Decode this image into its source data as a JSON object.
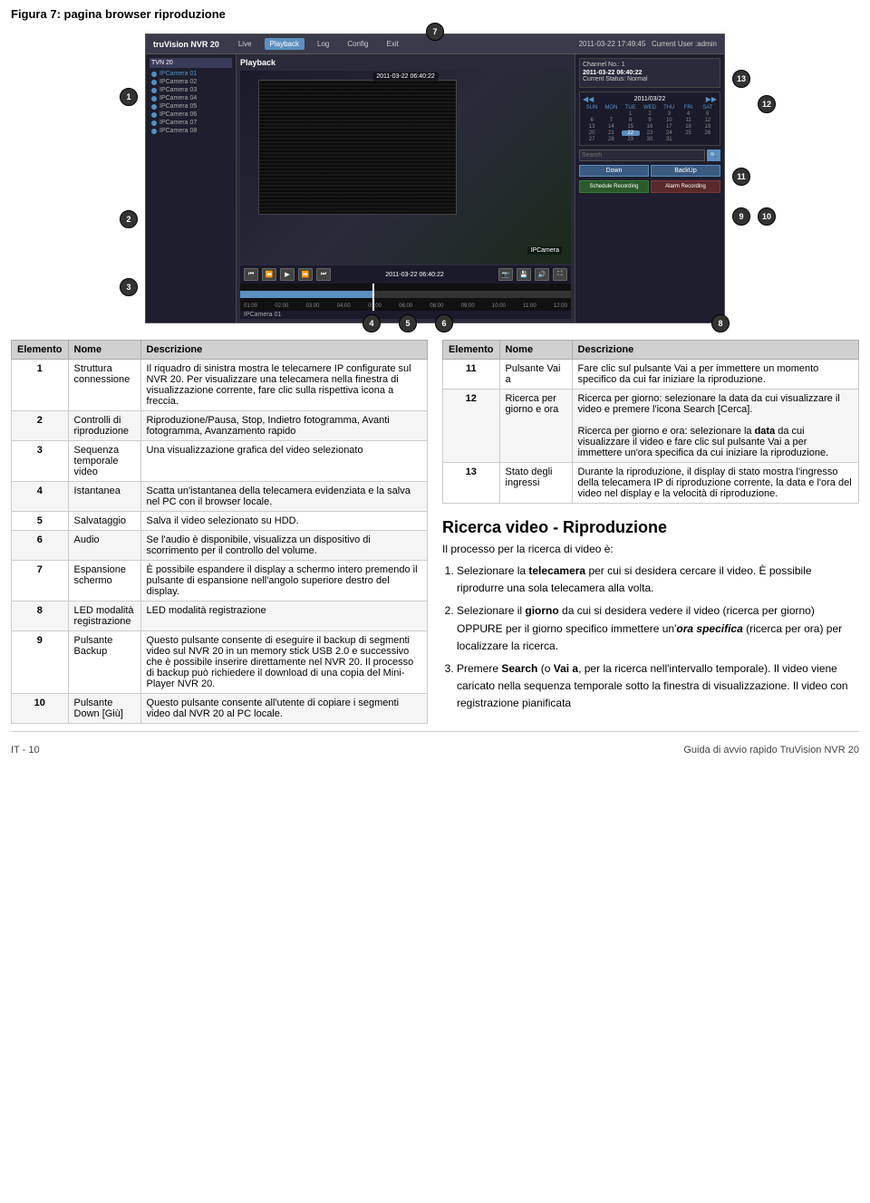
{
  "page": {
    "title": "Figura 7: pagina browser riproduzione",
    "footer_left": "IT - 10",
    "footer_right": "Guida di avvio rapido TruVision NVR 20"
  },
  "nvr_ui": {
    "logo": "truVision NVR 20",
    "nav_items": [
      "Live",
      "Playback",
      "Log",
      "Config",
      "Exit"
    ],
    "active_nav": "Playback",
    "timestamp": "2011-03-22 17:49:45",
    "current_user": "Current User :admin",
    "sidebar_title": "TVN 20",
    "cameras": [
      "IPCamera 01",
      "IPCamera 02",
      "IPCamera 03",
      "IPCamera 04",
      "IPCamera 05",
      "IPCamera 06",
      "IPCamera 07",
      "IPCamera 08"
    ],
    "playback_title": "Playback",
    "video_timestamp": "2011-03-22 06:40:22",
    "cam_label": "IPCamera 01",
    "timeline_times": [
      "01:00",
      "02:00",
      "03:00",
      "04:00",
      "05:00",
      "06:00",
      "07:00",
      "08:00",
      "09:00",
      "10:00",
      "11:00",
      "12:00"
    ],
    "channel_no": "Channel No.: 1",
    "channel_time": "2011-03-22 06:40:22",
    "status": "Current Status: Normal",
    "calendar_title": "2011/03/22",
    "calendar_month": "2011/03/22",
    "search_placeholder": "Search",
    "down_btn": "Down",
    "backup_btn": "BackUp",
    "schedule_btn": "Schedule Recording",
    "alarm_btn": "Alarm Recording"
  },
  "callout_numbers": [
    "1",
    "2",
    "3",
    "4",
    "5",
    "6",
    "7",
    "8",
    "9",
    "10",
    "11",
    "12",
    "13"
  ],
  "left_table": {
    "headers": [
      "Elemento",
      "Nome",
      "Descrizione"
    ],
    "rows": [
      {
        "num": "1",
        "name": "Struttura connessione",
        "desc": "Il riquadro di sinistra mostra le telecamere IP configurate sul NVR 20. Per visualizzare una telecamera nella finestra di visualizzazione corrente, fare clic sulla rispettiva icona a freccia."
      },
      {
        "num": "2",
        "name": "Controlli di riproduzione",
        "desc": "Riproduzione/Pausa, Stop, Indietro fotogramma, Avanti fotogramma, Avanzamento rapido"
      },
      {
        "num": "3",
        "name": "Sequenza temporale video",
        "desc": "Una visualizzazione grafica del video selezionato"
      },
      {
        "num": "4",
        "name": "Istantanea",
        "desc": "Scatta un'istantanea della telecamera evidenziata e la salva nel PC con il browser locale."
      },
      {
        "num": "5",
        "name": "Salvataggio",
        "desc": "Salva il video selezionato su HDD."
      },
      {
        "num": "6",
        "name": "Audio",
        "desc": "Se l'audio è disponibile, visualizza un dispositivo di scorrimento per il controllo del volume."
      },
      {
        "num": "7",
        "name": "Espansione schermo",
        "desc": "È possibile espandere il display a schermo intero premendo il pulsante di espansione nell'angolo superiore destro del display."
      },
      {
        "num": "8",
        "name": "LED modalità registrazione",
        "desc": "LED modalità registrazione"
      },
      {
        "num": "9",
        "name": "Pulsante Backup",
        "desc": "Questo pulsante consente di eseguire il backup di segmenti video sul NVR 20 in un memory stick USB 2.0 e successivo che è possibile inserire direttamente nel NVR 20. Il processo di backup può richiedere il download di una copia del Mini-Player NVR 20."
      },
      {
        "num": "10",
        "name": "Pulsante Down [Giù]",
        "desc": "Questo pulsante consente all'utente di copiare i segmenti video dal NVR 20 al PC locale."
      }
    ]
  },
  "right_table": {
    "headers": [
      "Elemento",
      "Nome",
      "Descrizione"
    ],
    "rows": [
      {
        "num": "11",
        "name": "Pulsante Vai a",
        "desc": "Fare clic sul pulsante Vai a per immettere un momento specifico da cui far iniziare la riproduzione."
      },
      {
        "num": "12",
        "name": "Ricerca per giorno e ora",
        "desc": "Ricerca per giorno: selezionare la data da cui visualizzare il video e premere l'icona Search [Cerca].\n\nRicerca per giorno e ora: selezionare la data da cui visualizzare il video e fare clic sul pulsante Vai a per immettere un'ora specifica da cui iniziare la riproduzione."
      },
      {
        "num": "13",
        "name": "Stato degli ingressi",
        "desc": "Durante la riproduzione, il display di stato mostra l'ingresso della telecamera IP di riproduzione corrente, la data e l'ora del video nel display e la velocità di riproduzione."
      }
    ]
  },
  "right_section": {
    "title": "Ricerca video - Riproduzione",
    "subtitle": "Il processo per la ricerca di video è:",
    "steps": [
      {
        "num": "1",
        "text_parts": [
          {
            "text": "Selezionare la ",
            "style": "normal"
          },
          {
            "text": "telecamera",
            "style": "bold"
          },
          {
            "text": " per cui si desidera cercare il video. È possibile riprodurre una sola telecamera alla volta.",
            "style": "normal"
          }
        ],
        "full_text": "Selezionare la telecamera per cui si desidera cercare il video. È possibile riprodurre una sola telecamera alla volta."
      },
      {
        "num": "2",
        "text_parts": [
          {
            "text": "Selezionare il ",
            "style": "normal"
          },
          {
            "text": "giorno",
            "style": "bold"
          },
          {
            "text": " da cui si desidera vedere il video (ricerca per giorno) OPPURE per il giorno specifico immettere un'",
            "style": "normal"
          },
          {
            "text": "ora specifica",
            "style": "bold-italic"
          },
          {
            "text": " (ricerca per ora) per localizzare la ricerca.",
            "style": "normal"
          }
        ],
        "full_text": "Selezionare il giorno da cui si desidera vedere il video (ricerca per giorno) OPPURE per il giorno specifico immettere un'ora specifica (ricerca per ora) per localizzare la ricerca."
      },
      {
        "num": "3",
        "text_parts": [
          {
            "text": "Premere ",
            "style": "normal"
          },
          {
            "text": "Search",
            "style": "bold"
          },
          {
            "text": " (o ",
            "style": "normal"
          },
          {
            "text": "Vai a",
            "style": "bold"
          },
          {
            "text": ", per la ricerca nell'intervallo temporale). Il video viene caricato nella sequenza temporale sotto la finestra di visualizzazione. Il video con registrazione pianificata",
            "style": "normal"
          }
        ],
        "full_text": "Premere Search (o Vai a, per la ricerca nell'intervallo temporale). Il video viene caricato nella sequenza temporale sotto la finestra di visualizzazione. Il video con registrazione pianificata"
      }
    ]
  },
  "footer": {
    "left": "IT - 10",
    "right": "Guida di avvio rapido TruVision NVR 20"
  }
}
